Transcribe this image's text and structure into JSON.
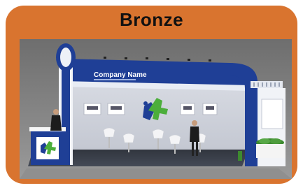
{
  "package": {
    "title": "Bronze"
  },
  "booth": {
    "header_text": "Company Name",
    "colors": {
      "primary": "#1f3f96",
      "accent_green": "#4cae3b",
      "frame_orange": "#d9742f"
    }
  }
}
